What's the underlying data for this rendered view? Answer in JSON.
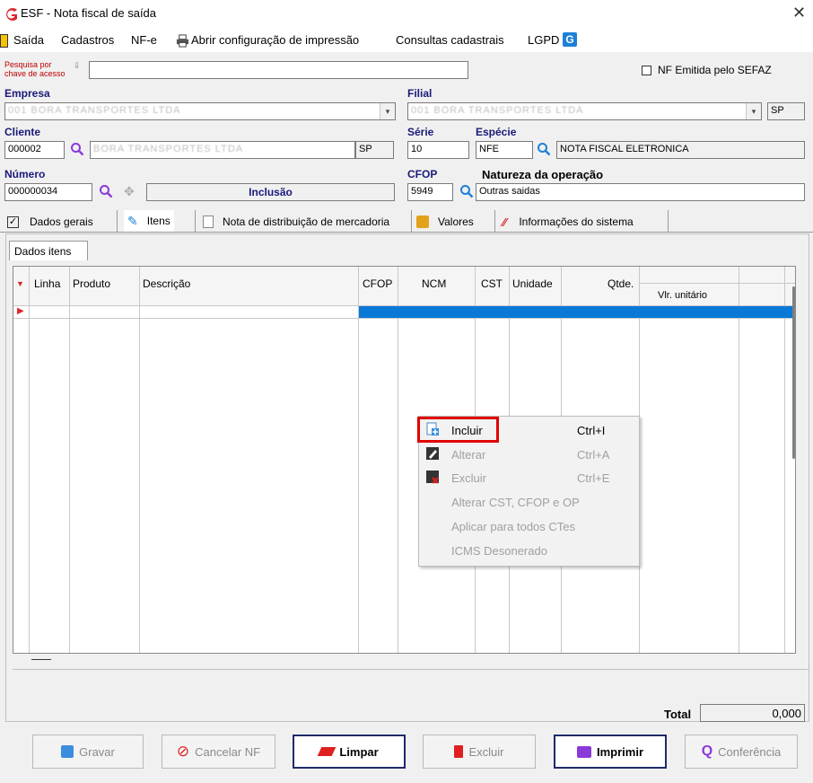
{
  "window": {
    "title": "ESF - Nota fiscal de saída",
    "close_glyph": "✕"
  },
  "menu": [
    "Saída",
    "Cadastros",
    "NF-e",
    "Abrir configuração de impressão",
    "Consultas cadastrais",
    "LGPD"
  ],
  "search": {
    "label_line1": "Pesquisa por",
    "label_line2": "chave de acesso",
    "value": ""
  },
  "nf_sefaz": {
    "label": "NF Emitida pelo SEFAZ",
    "checked": false
  },
  "empresa": {
    "label": "Empresa",
    "value": "001 BORA TRANSPORTES LTDA"
  },
  "filial": {
    "label": "Filial",
    "value": "001 BORA TRANSPORTES LTDA",
    "uf": "SP"
  },
  "cliente": {
    "label": "Cliente",
    "code": "000002",
    "name": "BORA TRANSPORTES LTDA",
    "uf": "SP"
  },
  "serie": {
    "label": "Série",
    "value": "10"
  },
  "especie": {
    "label": "Espécie",
    "code": "NFE",
    "desc": "NOTA FISCAL ELETRONICA"
  },
  "numero": {
    "label": "Número",
    "value": "000000034",
    "status": "Inclusão"
  },
  "cfop": {
    "label": "CFOP",
    "value": "5949"
  },
  "natureza": {
    "label": "Natureza da operação",
    "value": "Outras saidas"
  },
  "tabs": [
    "Dados gerais",
    "Itens",
    "Nota de distribuição de mercadoria",
    "Valores",
    "Informações do sistema"
  ],
  "subtab": "Dados itens",
  "grid": {
    "columns": [
      "Linha",
      "Produto",
      "Descrição",
      "CFOP",
      "NCM",
      "CST",
      "Unidade",
      "Qtde.",
      "Vlr. unitário"
    ]
  },
  "context_menu": [
    {
      "label": "Incluir",
      "shortcut": "Ctrl+I",
      "enabled": true
    },
    {
      "label": "Alterar",
      "shortcut": "Ctrl+A",
      "enabled": false
    },
    {
      "label": "Excluir",
      "shortcut": "Ctrl+E",
      "enabled": false
    },
    {
      "label": "Alterar CST, CFOP e OP",
      "shortcut": "",
      "enabled": false
    },
    {
      "label": "Aplicar para todos CTes",
      "shortcut": "",
      "enabled": false
    },
    {
      "label": "ICMS Desonerado",
      "shortcut": "",
      "enabled": false
    }
  ],
  "total": {
    "label": "Total",
    "value": "0,000"
  },
  "buttons": {
    "gravar": {
      "label": "Gravar",
      "enabled": false
    },
    "cancelar": {
      "label": "Cancelar NF",
      "enabled": false
    },
    "limpar": {
      "label": "Limpar",
      "enabled": true
    },
    "excluir": {
      "label": "Excluir",
      "enabled": false
    },
    "imprimir": {
      "label": "Imprimir",
      "enabled": true
    },
    "conferencia": {
      "label": "Conferência",
      "enabled": false
    }
  },
  "colors": {
    "accent": "#d9282f",
    "selection": "#0a78d7",
    "highlight_box": "#e00000",
    "label": "#1a1a7a"
  }
}
